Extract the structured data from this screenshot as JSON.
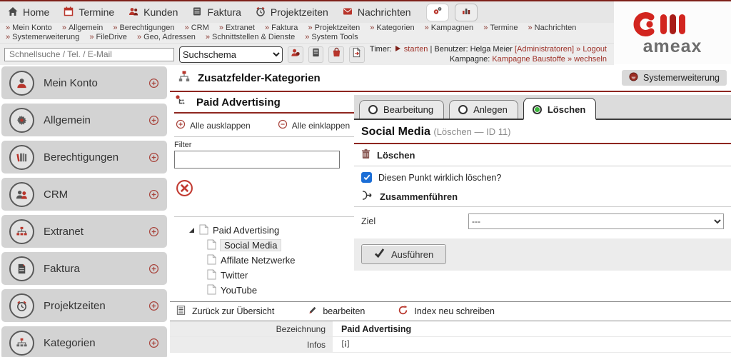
{
  "colors": {
    "accent_red": "#8e2620",
    "link_red": "#9d2f26",
    "logo_red": "#d2251f",
    "checkbox_blue": "#1b6ed6",
    "radio_green": "#3db53d"
  },
  "topnav": {
    "items": [
      {
        "label": "Home",
        "icon": "home-icon"
      },
      {
        "label": "Termine",
        "icon": "calendar-icon"
      },
      {
        "label": "Kunden",
        "icon": "people-icon"
      },
      {
        "label": "Faktura",
        "icon": "invoice-icon"
      },
      {
        "label": "Projektzeiten",
        "icon": "alarm-clock-icon"
      },
      {
        "label": "Nachrichten",
        "icon": "envelope-icon"
      }
    ]
  },
  "breadcrumbs": {
    "sep": "»",
    "row1": [
      "Mein Konto",
      "Allgemein",
      "Berechtigungen",
      "CRM",
      "Extranet",
      "Faktura",
      "Projektzeiten",
      "Kategorien",
      "Kampagnen",
      "Termine",
      "Nachrichten"
    ],
    "row2": [
      "Systemerweiterung",
      "FileDrive",
      "Geo, Adressen",
      "Schnittstellen & Dienste",
      "System Tools"
    ]
  },
  "search": {
    "placeholder": "Schnellsuche / Tel. / E-Mail",
    "schema": "Suchschema",
    "timer": {
      "label": "Timer:",
      "start": "starten",
      "divider": "|",
      "user_label": "Benutzer:",
      "user_name": "Helga Meier",
      "user_role": "[Administratoren]",
      "logout": "» Logout",
      "campaign_label": "Kampagne:",
      "campaign_name": "Kampagne Baustoffe",
      "campaign_switch": "» wechseln"
    }
  },
  "logo": {
    "text": "ameax"
  },
  "content": {
    "title": "Zusatzfelder-Kategorien",
    "system_button": "Systemerweiterung"
  },
  "sidebar": {
    "items": [
      {
        "label": "Mein Konto",
        "icon": "person-icon"
      },
      {
        "label": "Allgemein",
        "icon": "gear-icon"
      },
      {
        "label": "Berechtigungen",
        "icon": "books-icon"
      },
      {
        "label": "CRM",
        "icon": "people-icon"
      },
      {
        "label": "Extranet",
        "icon": "network-icon"
      },
      {
        "label": "Faktura",
        "icon": "document-icon"
      },
      {
        "label": "Projektzeiten",
        "icon": "alarm-clock-icon"
      },
      {
        "label": "Kategorien",
        "icon": "hierarchy-icon"
      }
    ]
  },
  "tree": {
    "title": "Paid Advertising",
    "expand_all": "Alle ausklappen",
    "collapse_all": "Alle einklappen",
    "filter_label": "Filter",
    "filter_value": "",
    "root": "Paid Advertising",
    "children": [
      "Social Media",
      "Affilate Netzwerke",
      "Twitter",
      "YouTube"
    ],
    "selected": "Social Media"
  },
  "detail": {
    "tabs": [
      {
        "label": "Bearbeitung",
        "active": false
      },
      {
        "label": "Anlegen",
        "active": false
      },
      {
        "label": "Löschen",
        "active": true
      }
    ],
    "heading": "Social Media",
    "heading_note": "(Löschen — ID 11)",
    "delete_title": "Löschen",
    "confirm_label": "Diesen Punkt wirklich löschen?",
    "confirm_checked": true,
    "merge_title": "Zusammenführen",
    "target_label": "Ziel",
    "target_value": "---",
    "execute_label": "Ausführen"
  },
  "footer": {
    "back": "Zurück zur Übersicht",
    "edit": "bearbeiten",
    "reindex": "Index neu schreiben",
    "rows": [
      {
        "label": "Bezeichnung",
        "value": "Paid Advertising",
        "icon": ""
      },
      {
        "label": "Infos",
        "value": "",
        "icon": "info-icon"
      }
    ]
  }
}
